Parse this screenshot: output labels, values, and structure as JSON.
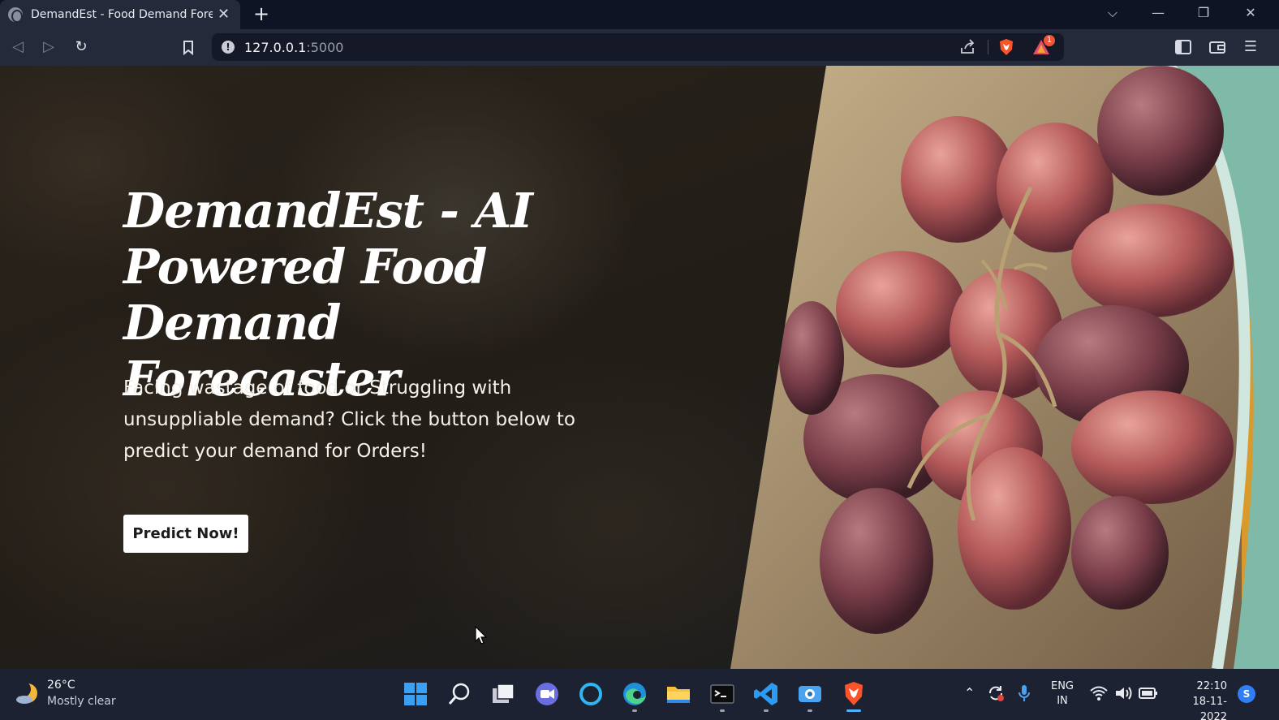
{
  "browser": {
    "tab": {
      "title": "DemandEst - Food Demand Forec",
      "close_glyph": "✕"
    },
    "new_tab_glyph": "+",
    "url": {
      "host": "127.0.0.1",
      "port": ":5000"
    },
    "rewards_badge": "1"
  },
  "hero": {
    "title": "DemandEst - AI Powered Food Demand Forecaster",
    "subtitle": "Facing wastage of food or Struggling with unsuppliable demand? Click the button below to predict your demand for Orders!",
    "button_label": "Predict Now!"
  },
  "taskbar": {
    "weather": {
      "temp": "26°C",
      "desc": "Mostly clear"
    },
    "lang": {
      "line1": "ENG",
      "line2": "IN"
    },
    "clock": {
      "time": "22:10",
      "date": "18-11-2022"
    },
    "notification_badge": "S"
  },
  "colors": {
    "accent_brave": "#fb542b",
    "taskbar_bg": "#1c2231",
    "toolbar_bg": "#252a3a",
    "button_bg": "#ffffff"
  },
  "icons": [
    "globe-favicon-icon",
    "back-icon",
    "forward-icon",
    "reload-icon",
    "bookmark-icon",
    "site-info-icon",
    "share-icon",
    "brave-shield-icon",
    "brave-rewards-icon",
    "sidebar-icon",
    "wallet-icon",
    "menu-icon",
    "windows-start-icon",
    "search-icon",
    "task-view-icon",
    "teams-chat-icon",
    "cortana-icon",
    "edge-icon",
    "file-explorer-icon",
    "terminal-icon",
    "vscode-icon",
    "camera-app-icon",
    "brave-app-icon",
    "chevron-up-icon",
    "sync-icon",
    "microphone-icon",
    "wifi-icon",
    "volume-icon",
    "battery-icon"
  ]
}
